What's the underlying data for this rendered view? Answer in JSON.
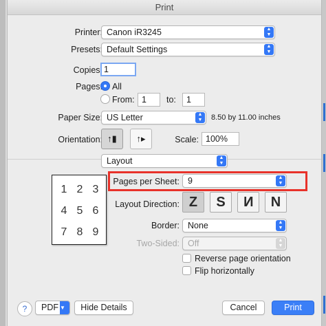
{
  "window": {
    "title": "Print"
  },
  "printer": {
    "label": "Printer:",
    "value": "Canon iR3245"
  },
  "presets": {
    "label": "Presets:",
    "value": "Default Settings"
  },
  "copies": {
    "label": "Copies:",
    "value": "1"
  },
  "pages": {
    "label": "Pages:",
    "all_label": "All",
    "from_label": "From:",
    "from_value": "1",
    "to_label": "to:",
    "to_value": "1",
    "selected": "All"
  },
  "paper_size": {
    "label": "Paper Size:",
    "value": "US Letter",
    "dimensions": "8.50 by 11.00 inches"
  },
  "orientation": {
    "label": "Orientation:",
    "selected": "portrait"
  },
  "scale": {
    "label": "Scale:",
    "value": "100%"
  },
  "panel_select": {
    "value": "Layout"
  },
  "preview_grid": [
    "1",
    "2",
    "3",
    "4",
    "5",
    "6",
    "7",
    "8",
    "9"
  ],
  "pages_per_sheet": {
    "label": "Pages per Sheet:",
    "value": "9"
  },
  "layout_direction": {
    "label": "Layout Direction:",
    "glyphs": [
      "Z",
      "S",
      "N",
      "N"
    ],
    "selected_index": 0
  },
  "border": {
    "label": "Border:",
    "value": "None"
  },
  "two_sided": {
    "label": "Two-Sided:",
    "value": "Off",
    "enabled": false
  },
  "options": {
    "reverse_label": "Reverse page orientation",
    "flip_label": "Flip horizontally"
  },
  "footer": {
    "help": "?",
    "pdf": "PDF",
    "hide_details": "Hide Details",
    "cancel": "Cancel",
    "print": "Print"
  },
  "colors": {
    "accent": "#3478f6",
    "highlight": "#e8322a"
  }
}
